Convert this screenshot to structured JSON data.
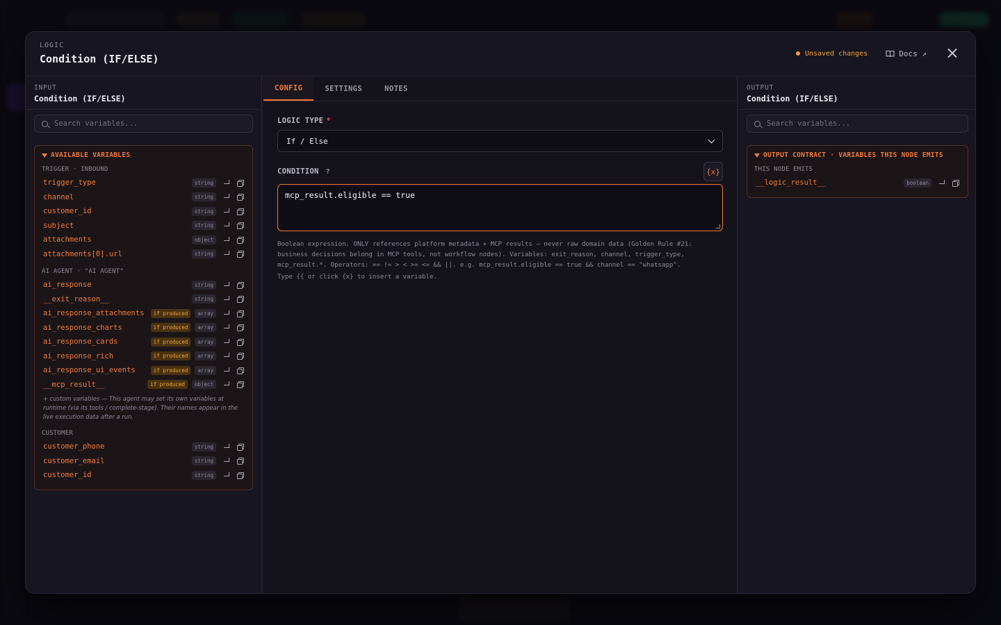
{
  "modal": {
    "eyebrow": "LOGIC",
    "title": "Condition (IF/ELSE)",
    "unsaved": "Unsaved changes",
    "docs": "Docs ↗"
  },
  "input_panel": {
    "eyebrow": "INPUT",
    "name": "Condition (IF/ELSE)",
    "search_placeholder": "Search variables...",
    "box_title": "AVAILABLE VARIABLES",
    "groups": [
      {
        "label": "TRIGGER · INBOUND",
        "vars": [
          {
            "name": "trigger_type",
            "type": "string"
          },
          {
            "name": "channel",
            "type": "string"
          },
          {
            "name": "customer_id",
            "type": "string"
          },
          {
            "name": "subject",
            "type": "string"
          },
          {
            "name": "attachments",
            "type": "object"
          },
          {
            "name": "attachments[0].url",
            "type": "string"
          }
        ]
      },
      {
        "label": "AI AGENT · \"AI AGENT\"",
        "vars": [
          {
            "name": "ai_response",
            "type": "string"
          },
          {
            "name": "__exit_reason__",
            "type": "string"
          },
          {
            "name": "ai_response_attachments",
            "type": "array",
            "badge": "if produced"
          },
          {
            "name": "ai_response_charts",
            "type": "array",
            "badge": "if produced"
          },
          {
            "name": "ai_response_cards",
            "type": "array",
            "badge": "if produced"
          },
          {
            "name": "ai_response_rich",
            "type": "array",
            "badge": "if produced"
          },
          {
            "name": "ai_response_ui_events",
            "type": "array",
            "badge": "if produced"
          },
          {
            "name": "__mcp_result__",
            "type": "object",
            "badge": "if produced"
          }
        ],
        "note": "+ custom variables — This agent may set its own variables at runtime (via its tools / complete-stage). Their names appear in the live execution data after a run."
      },
      {
        "label": "CUSTOMER",
        "vars": [
          {
            "name": "customer_phone",
            "type": "string"
          },
          {
            "name": "customer_email",
            "type": "string"
          },
          {
            "name": "customer_id",
            "type": "string"
          }
        ]
      }
    ]
  },
  "config_panel": {
    "tabs": [
      "CONFIG",
      "SETTINGS",
      "NOTES"
    ],
    "logic_type_label": "LOGIC TYPE",
    "logic_type_value": "If / Else",
    "condition_label": "CONDITION",
    "help_mark": "?",
    "var_button": "{x}",
    "condition_value": "mcp_result.eligible == true",
    "hint": "Boolean expression. ONLY references platform metadata + MCP results — never raw domain data (Golden Rule #21: business decisions belong in MCP tools, not workflow nodes). Variables: exit_reason, channel, trigger_type, mcp_result.*. Operators: == != > < >= <= && ||. e.g. mcp_result.eligible == true && channel == \"whatsapp\".",
    "hint2": "Type {{ or click {x} to insert a variable."
  },
  "output_panel": {
    "eyebrow": "OUTPUT",
    "name": "Condition (IF/ELSE)",
    "search_placeholder": "Search variables...",
    "box_title": "OUTPUT CONTRACT · VARIABLES THIS NODE EMITS",
    "group_label": "THIS NODE EMITS",
    "vars": [
      {
        "name": "__logic_result__",
        "type": "boolean"
      }
    ]
  },
  "colors": {
    "accent": "#f07a3a",
    "warning": "#f0a03a",
    "background": "#17151f"
  }
}
